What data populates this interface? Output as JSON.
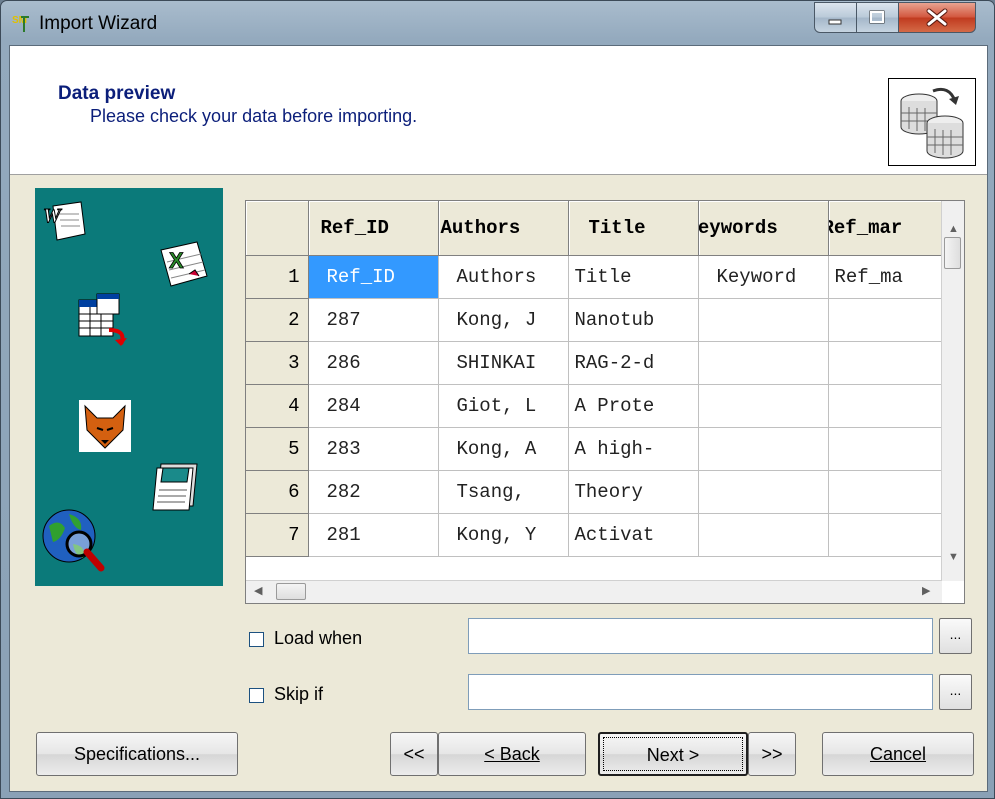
{
  "window": {
    "title": "Import Wizard",
    "app_icon_text": "SM"
  },
  "header": {
    "title": "Data preview",
    "subtitle": "Please check your data before importing."
  },
  "grid": {
    "columns": [
      "",
      "Ref_ID",
      "Authors",
      "Title",
      "Keywords",
      "Ref_mar"
    ],
    "rows": [
      {
        "num": "1",
        "cells": [
          "Ref_ID",
          "Authors",
          "Title",
          "Keyword",
          "Ref_ma"
        ]
      },
      {
        "num": "2",
        "cells": [
          "287",
          "Kong, J",
          "Nanotub",
          "",
          ""
        ]
      },
      {
        "num": "3",
        "cells": [
          "286",
          "SHINKAI",
          "RAG-2-d",
          "",
          ""
        ]
      },
      {
        "num": "4",
        "cells": [
          "284",
          "Giot, L",
          "A Prote",
          "",
          ""
        ]
      },
      {
        "num": "5",
        "cells": [
          "283",
          "Kong, A",
          "A high-",
          "",
          ""
        ]
      },
      {
        "num": "6",
        "cells": [
          "282",
          "Tsang,",
          "Theory",
          "",
          ""
        ]
      },
      {
        "num": "7",
        "cells": [
          "281",
          "Kong, Y",
          "Activat",
          "",
          ""
        ]
      }
    ]
  },
  "options": {
    "load_when": {
      "label": "Load when",
      "checked": false,
      "value": "",
      "browse": "..."
    },
    "skip_if": {
      "label": "Skip if",
      "checked": false,
      "value": "",
      "browse": "..."
    }
  },
  "buttons": {
    "specifications": "Specifications...",
    "first": "<<",
    "back": "< Back",
    "next": "Next >",
    "last": ">>",
    "cancel": "Cancel"
  },
  "colors": {
    "side_panel": "#0b7a7a",
    "selection": "#3399ff",
    "header_text": "#0b1e7a"
  },
  "side_icons": [
    "word-document-icon",
    "excel-spreadsheet-icon",
    "table-import-icon",
    "fox-icon",
    "notepad-icon",
    "globe-search-icon"
  ]
}
